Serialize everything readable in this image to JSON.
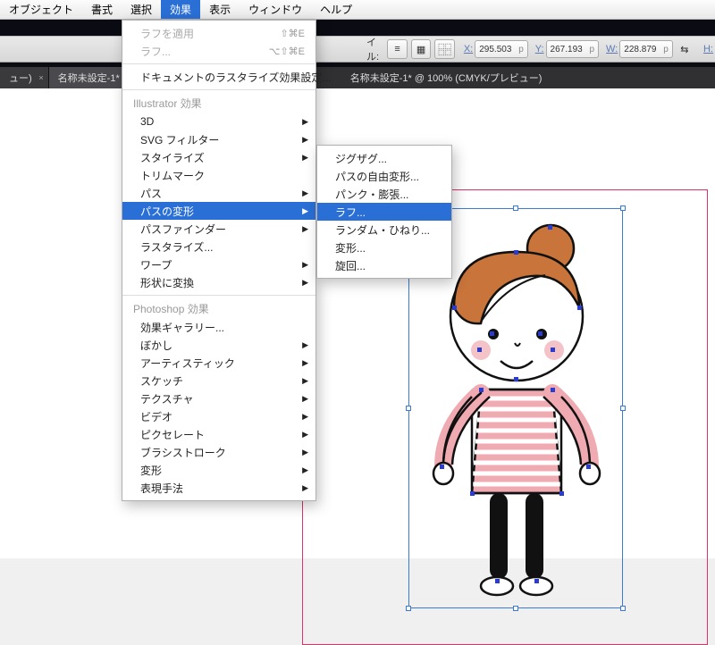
{
  "menubar": {
    "items": [
      "オブジェクト",
      "書式",
      "選択",
      "効果",
      "表示",
      "ウィンドウ",
      "ヘルプ"
    ],
    "activeIndex": 3
  },
  "toolbar": {
    "file_label": "イル:",
    "x_label": "X:",
    "y_label": "Y:",
    "w_label": "W:",
    "h_label": "H:",
    "x_value": "295.503",
    "y_value": "267.193",
    "w_value": "228.879"
  },
  "doctabs": {
    "tab1_suffix": "ュー)",
    "tab2": "名称未設定-1* @ 100%",
    "center": "名称未設定-1* @ 100% (CMYK/プレビュー)"
  },
  "effects_menu": {
    "apply": "ラフを適用",
    "apply_sc": "⇧⌘E",
    "last": "ラフ...",
    "last_sc": "⌥⇧⌘E",
    "raster": "ドキュメントのラスタライズ効果設定...",
    "header1": "Illustrator 効果",
    "items1": [
      "3D",
      "SVG フィルター",
      "スタイライズ",
      "トリムマーク",
      "パス",
      "パスの変形",
      "パスファインダー",
      "ラスタライズ...",
      "ワープ",
      "形状に変換"
    ],
    "header2": "Photoshop 効果",
    "items2": [
      "効果ギャラリー...",
      "ぼかし",
      "アーティスティック",
      "スケッチ",
      "テクスチャ",
      "ビデオ",
      "ピクセレート",
      "ブラシストローク",
      "変形",
      "表現手法"
    ],
    "highlightedIndex": 5
  },
  "submenu": {
    "items": [
      "ジグザグ...",
      "パスの自由変形...",
      "パンク・膨張...",
      "ラフ...",
      "ランダム・ひねり...",
      "変形...",
      "旋回..."
    ],
    "highlightedIndex": 3
  },
  "colors": {
    "hair": "#c8743a",
    "hair_dark": "#111",
    "skin": "#fff",
    "cheek": "#f4c3c8",
    "shirt": "#f0aab2",
    "stripe": "#fff",
    "pants": "#111",
    "selection": "#2a3bd0"
  }
}
